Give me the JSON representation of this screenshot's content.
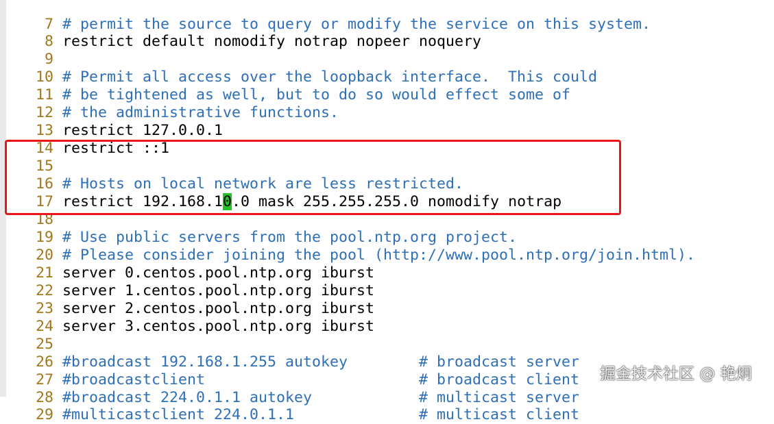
{
  "editor": {
    "lines": [
      {
        "num": "7",
        "kind": "comment",
        "text": "# permit the source to query or modify the service on this system."
      },
      {
        "num": "8",
        "kind": "code",
        "text": "restrict default nomodify notrap nopeer noquery"
      },
      {
        "num": "9",
        "kind": "code",
        "text": ""
      },
      {
        "num": "10",
        "kind": "comment",
        "text": "# Permit all access over the loopback interface.  This could"
      },
      {
        "num": "11",
        "kind": "comment",
        "text": "# be tightened as well, but to do so would effect some of"
      },
      {
        "num": "12",
        "kind": "comment",
        "text": "# the administrative functions."
      },
      {
        "num": "13",
        "kind": "code",
        "text": "restrict 127.0.0.1"
      },
      {
        "num": "14",
        "kind": "code",
        "text": "restrict ::1"
      },
      {
        "num": "15",
        "kind": "code",
        "text": ""
      },
      {
        "num": "16",
        "kind": "comment",
        "text": "# Hosts on local network are less restricted."
      },
      {
        "num": "17",
        "kind": "code",
        "text": "restrict 192.168.10.0 mask 255.255.255.0 nomodify notrap",
        "before_cursor": "restrict 192.168.1",
        "cursor_char": "0",
        "after_cursor": ".0 mask 255.255.255.0 nomodify notrap"
      },
      {
        "num": "18",
        "kind": "code",
        "text": ""
      },
      {
        "num": "19",
        "kind": "comment",
        "text": "# Use public servers from the pool.ntp.org project."
      },
      {
        "num": "20",
        "kind": "comment",
        "text": "# Please consider joining the pool (http://www.pool.ntp.org/join.html)."
      },
      {
        "num": "21",
        "kind": "code",
        "text": "server 0.centos.pool.ntp.org iburst"
      },
      {
        "num": "22",
        "kind": "code",
        "text": "server 1.centos.pool.ntp.org iburst"
      },
      {
        "num": "23",
        "kind": "code",
        "text": "server 2.centos.pool.ntp.org iburst"
      },
      {
        "num": "24",
        "kind": "code",
        "text": "server 3.centos.pool.ntp.org iburst"
      },
      {
        "num": "25",
        "kind": "code",
        "text": ""
      },
      {
        "num": "26",
        "kind": "mixed",
        "code": "#broadcast 192.168.1.255 autokey        ",
        "comment": "# broadcast server"
      },
      {
        "num": "27",
        "kind": "mixed",
        "code": "#broadcastclient                        ",
        "comment": "# broadcast client"
      },
      {
        "num": "28",
        "kind": "mixed",
        "code": "#broadcast 224.0.1.1 autokey            ",
        "comment": "# multicast server"
      },
      {
        "num": "29",
        "kind": "mixed",
        "code": "#multicastclient 224.0.1.1              ",
        "comment": "# multicast client"
      }
    ]
  },
  "watermark": {
    "text": "掘金技术社区 @ 艳炯"
  },
  "colors": {
    "comment": "#2e6fb7",
    "code": "#000000",
    "line_number": "#a0781e",
    "cursor_bg": "#24c224",
    "highlight_border": "#e8161b"
  }
}
